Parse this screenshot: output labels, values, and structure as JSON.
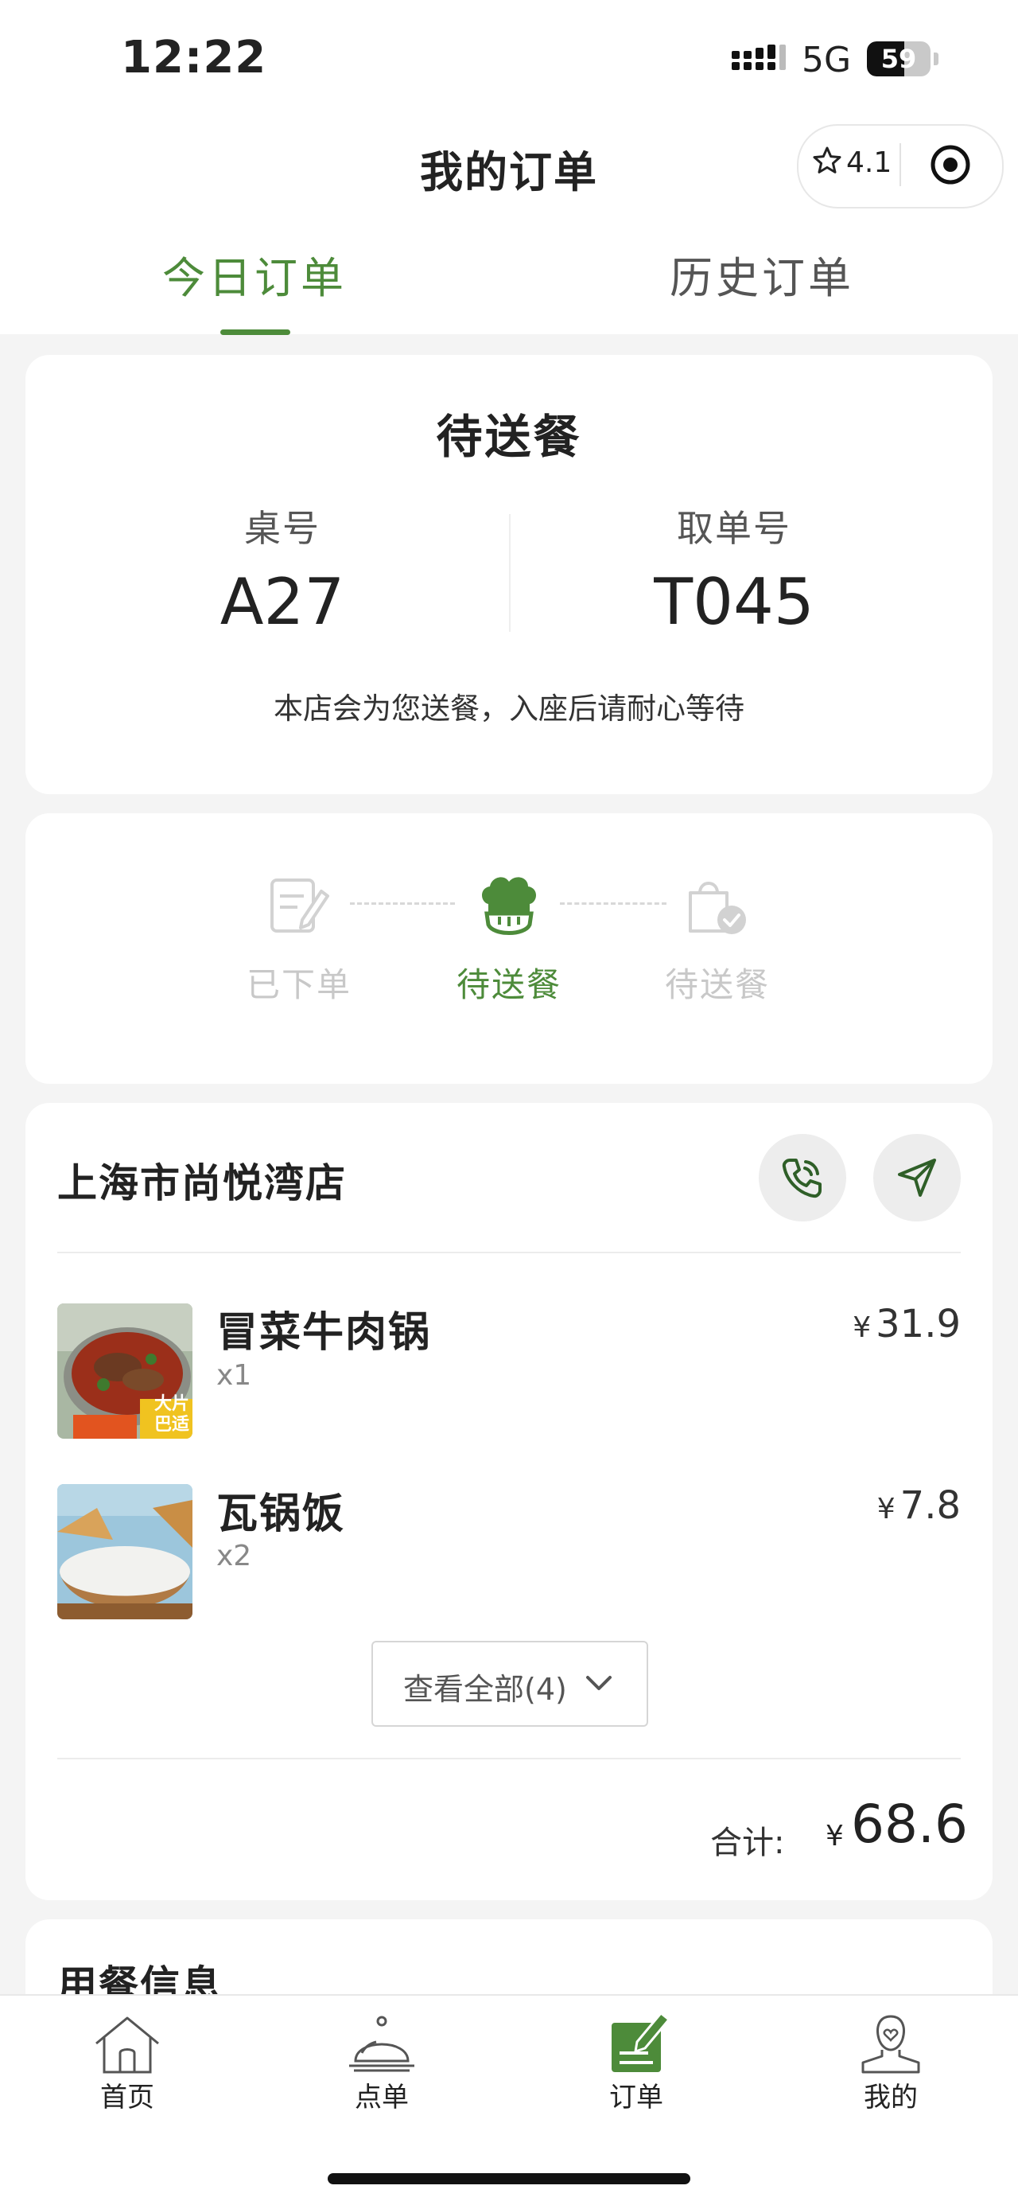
{
  "status_bar": {
    "time": "12:22",
    "network": "5G",
    "battery": "59",
    "battery_level": 0.59
  },
  "header": {
    "title": "我的订单",
    "rating": "4.1"
  },
  "tabs": [
    {
      "label": "今日订单",
      "active": true
    },
    {
      "label": "历史订单",
      "active": false
    }
  ],
  "order_status": {
    "title": "待送餐",
    "table_label": "桌号",
    "table_value": "A27",
    "pickup_label": "取单号",
    "pickup_value": "T045",
    "notice": "本店会为您送餐，入座后请耐心等待"
  },
  "progress": {
    "steps": [
      {
        "label": "已下单",
        "state": "inactive",
        "icon": "note-pencil-icon"
      },
      {
        "label": "待送餐",
        "state": "active",
        "icon": "chef-hat-icon"
      },
      {
        "label": "待送餐",
        "state": "inactive",
        "icon": "bag-check-icon"
      }
    ]
  },
  "store": {
    "name": "上海市尚悦湾店",
    "items": [
      {
        "name": "冒菜牛肉锅",
        "qty": "x1",
        "price": "31.9",
        "thumb_overlay": "大片\n巴适"
      },
      {
        "name": "瓦锅饭",
        "qty": "x2",
        "price": "7.8"
      }
    ],
    "view_all_label": "查看全部(4)",
    "total_label": "合计:",
    "currency": "¥",
    "total": "68.6"
  },
  "dining_info": {
    "title": "用餐信息"
  },
  "bottom_nav": [
    {
      "label": "首页",
      "icon": "home-icon"
    },
    {
      "label": "点单",
      "icon": "cloche-icon"
    },
    {
      "label": "订单",
      "icon": "order-icon",
      "active": true
    },
    {
      "label": "我的",
      "icon": "profile-icon"
    }
  ],
  "colors": {
    "accent": "#4d8b3a",
    "inactive": "#c8c8c8",
    "background": "#f4f4f4"
  }
}
